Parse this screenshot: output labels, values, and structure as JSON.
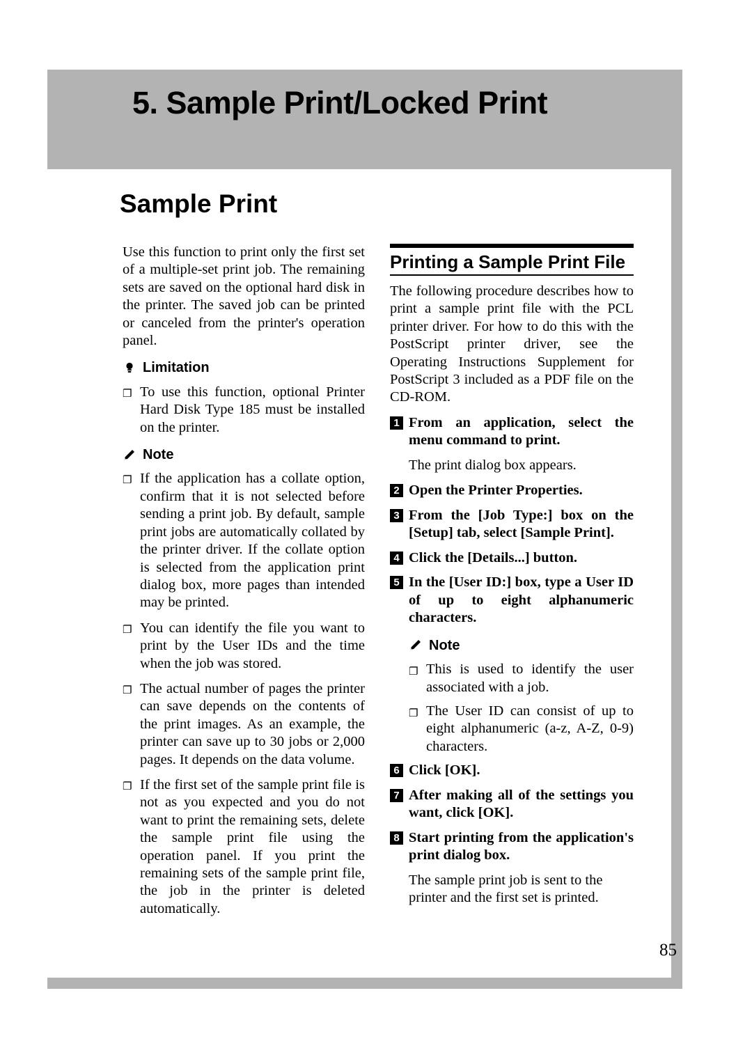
{
  "chapter": {
    "title": "5. Sample Print/Locked Print"
  },
  "section": {
    "title": "Sample Print"
  },
  "left_column": {
    "intro": "Use this function to print only the first set of a multiple-set print job. The remaining sets are saved on the optional hard disk in the printer. The saved job can be printed or canceled from the printer's operation panel.",
    "limitation_label": "Limitation",
    "limitation_items": [
      "To use this function, optional Printer Hard Disk Type 185 must be installed on the printer."
    ],
    "note_label": "Note",
    "note_items": [
      "If the application has a collate option, confirm that it is not selected before sending a print job. By default, sample print jobs are automatically collated by the printer driver. If the collate option is selected from the application print dialog box, more pages than intended may be printed.",
      "You can identify the file you want to print by the User IDs and the time when the job was stored.",
      "The actual number of pages the printer can save depends on the contents of the print images. As an example, the printer can save up to 30 jobs or 2,000 pages. It depends on the data volume.",
      "If the first set of the sample print file is not as you expected and you do not want to print the remaining sets, delete the sample print file using the operation panel. If you print the remaining sets of the sample print file, the job in the printer is deleted automatically."
    ]
  },
  "right_column": {
    "heading": "Printing a Sample Print File",
    "intro": "The following procedure describes how to print a sample print file with the PCL printer driver. For how to do this with the PostScript printer driver, see the Operating Instructions Supplement for PostScript 3 included as a PDF file on the CD-ROM.",
    "steps": [
      {
        "num": "1",
        "text_html": "From an application, select the menu command to print.",
        "after": "The print dialog box appears."
      },
      {
        "num": "2",
        "text_html": "Open the Printer Properties.",
        "after": ""
      },
      {
        "num": "3",
        "text_html": "From the [Job Type:] box on the [Setup] tab, select [Sample Print].",
        "after": ""
      },
      {
        "num": "4",
        "text_html": "Click the [Details...] button.",
        "after": ""
      },
      {
        "num": "5",
        "text_html": "In the [User ID:] box, type a User ID of up to eight alphanumeric characters.",
        "after": ""
      },
      {
        "num": "6",
        "text_html": "Click [OK].",
        "after": ""
      },
      {
        "num": "7",
        "text_html": "After making all of the settings you want, click [OK].",
        "after": ""
      },
      {
        "num": "8",
        "text_html": "Start printing from the application's print dialog box.",
        "after": "The sample print job is sent to the printer and the first set is printed."
      }
    ],
    "note_label": "Note",
    "note_items": [
      "This is used to identify the user associated with a job.",
      "The User ID can consist of up to eight alphanumeric (a-z, A-Z, 0-9) characters."
    ]
  },
  "page_number": "85",
  "glyphs": {
    "bullet_square": "❐",
    "limitation_icon": "limitation-icon",
    "note_icon": "pencil-icon"
  }
}
